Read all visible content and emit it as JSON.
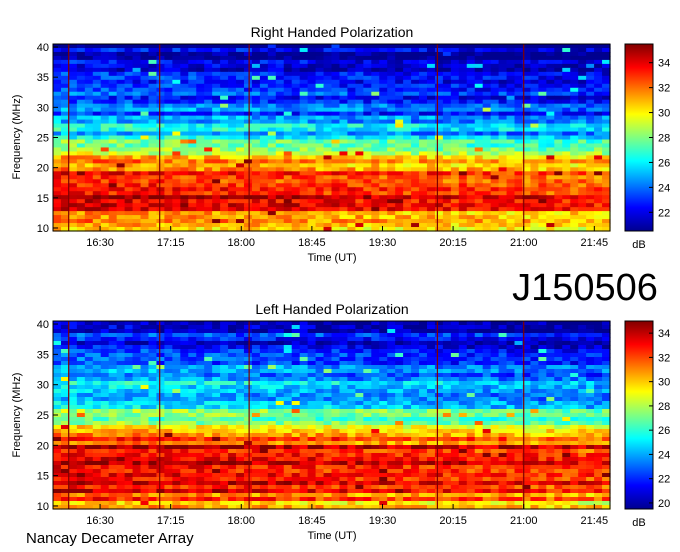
{
  "chart_data": [
    {
      "type": "heatmap",
      "title": "Right Handed Polarization",
      "xlabel": "Time (UT)",
      "ylabel": "Frequency (MHz)",
      "x_ticks": [
        "16:30",
        "17:15",
        "18:00",
        "18:45",
        "19:30",
        "20:15",
        "21:00",
        "21:45"
      ],
      "y_ticks": [
        10,
        15,
        20,
        25,
        30,
        35,
        40
      ],
      "xlim": [
        "16:00",
        "21:55"
      ],
      "ylim": [
        9.5,
        40.5
      ],
      "colorbar": {
        "label": "dB",
        "ticks": [
          22,
          24,
          26,
          28,
          30,
          32,
          34
        ],
        "range": [
          20.5,
          35.5
        ]
      },
      "colormap": [
        "#00008f",
        "#0000ff",
        "#0080ff",
        "#00ffff",
        "#80ff80",
        "#ffff00",
        "#ff8000",
        "#ff0000",
        "#800000"
      ],
      "marker_times": [
        "16:10",
        "17:08",
        "18:05",
        "20:05",
        "21:00"
      ],
      "intensity_profile": [
        {
          "freq_mhz": 10,
          "db": 31
        },
        {
          "freq_mhz": 14,
          "db": 34
        },
        {
          "freq_mhz": 18,
          "db": 34
        },
        {
          "freq_mhz": 21,
          "db": 31
        },
        {
          "freq_mhz": 24,
          "db": 27
        },
        {
          "freq_mhz": 28,
          "db": 25
        },
        {
          "freq_mhz": 33,
          "db": 23
        },
        {
          "freq_mhz": 40,
          "db": 21.5
        }
      ]
    },
    {
      "type": "heatmap",
      "title": "Left Handed Polarization",
      "xlabel": "Time (UT)",
      "ylabel": "Frequency (MHz)",
      "x_ticks": [
        "16:30",
        "17:15",
        "18:00",
        "18:45",
        "19:30",
        "20:15",
        "21:00",
        "21:45"
      ],
      "y_ticks": [
        10,
        15,
        20,
        25,
        30,
        35,
        40
      ],
      "xlim": [
        "16:00",
        "21:55"
      ],
      "ylim": [
        9.5,
        40.5
      ],
      "colorbar": {
        "label": "dB",
        "ticks": [
          20,
          22,
          24,
          26,
          28,
          30,
          32,
          34
        ],
        "range": [
          19.5,
          35.0
        ]
      },
      "colormap": [
        "#00008f",
        "#0000ff",
        "#0080ff",
        "#00ffff",
        "#80ff80",
        "#ffff00",
        "#ff8000",
        "#ff0000",
        "#800000"
      ],
      "marker_times": [
        "16:10",
        "17:08",
        "18:05",
        "20:05",
        "21:00"
      ],
      "intensity_profile": [
        {
          "freq_mhz": 10,
          "db": 31
        },
        {
          "freq_mhz": 14,
          "db": 34
        },
        {
          "freq_mhz": 19,
          "db": 34
        },
        {
          "freq_mhz": 22,
          "db": 31
        },
        {
          "freq_mhz": 25,
          "db": 27
        },
        {
          "freq_mhz": 29,
          "db": 25
        },
        {
          "freq_mhz": 34,
          "db": 23
        },
        {
          "freq_mhz": 40,
          "db": 21
        }
      ]
    }
  ],
  "observation_id": "J150506",
  "instrument": "Nancay Decameter Array"
}
